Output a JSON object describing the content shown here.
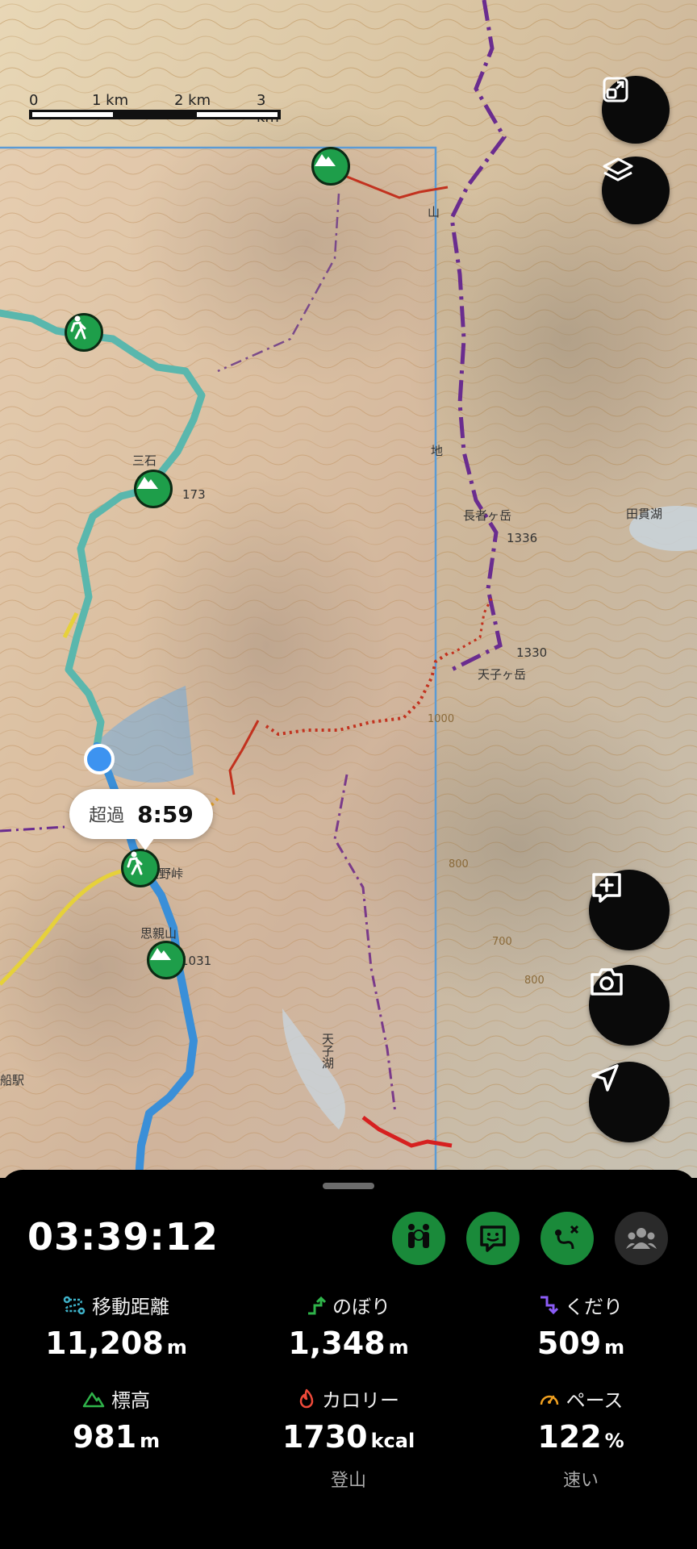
{
  "map": {
    "scale": {
      "labels": [
        "0",
        "1 km",
        "2 km",
        "3 km"
      ]
    },
    "place_labels": [
      "三石",
      "173",
      "長者ヶ岳",
      "1336",
      "1330",
      "天子ヶ岳",
      "田貫湖",
      "佐野峠",
      "思親山",
      "1031",
      "天子湖",
      "山",
      "地",
      "船駅",
      "1000",
      "800",
      "700",
      "800"
    ],
    "bubble": {
      "label": "超過",
      "value": "8:59"
    },
    "controls": [
      "expand-icon",
      "layers-icon",
      "add-note-icon",
      "camera-icon",
      "navigate-icon"
    ]
  },
  "panel": {
    "elapsed": "03:39:12",
    "action_icons": [
      "checkpoint-icon",
      "chat-icon",
      "route-icon",
      "group-icon"
    ],
    "stats": [
      {
        "label": "移動距離",
        "value": "11,208",
        "unit": "m",
        "icon": "distance-icon",
        "color": "#3fb2c9"
      },
      {
        "label": "のぼり",
        "value": "1,348",
        "unit": "m",
        "icon": "ascent-icon",
        "color": "#2fb34a"
      },
      {
        "label": "くだり",
        "value": "509",
        "unit": "m",
        "icon": "descent-icon",
        "color": "#8b5cf6"
      },
      {
        "label": "標高",
        "value": "981",
        "unit": "m",
        "icon": "elevation-icon",
        "color": "#2fb34a"
      },
      {
        "label": "カロリー",
        "value": "1730",
        "unit": "kcal",
        "sub": "登山",
        "icon": "calorie-icon",
        "color": "#ef4a3a"
      },
      {
        "label": "ペース",
        "value": "122",
        "unit": "%",
        "sub": "速い",
        "icon": "pace-icon",
        "color": "#f0a020"
      }
    ]
  }
}
